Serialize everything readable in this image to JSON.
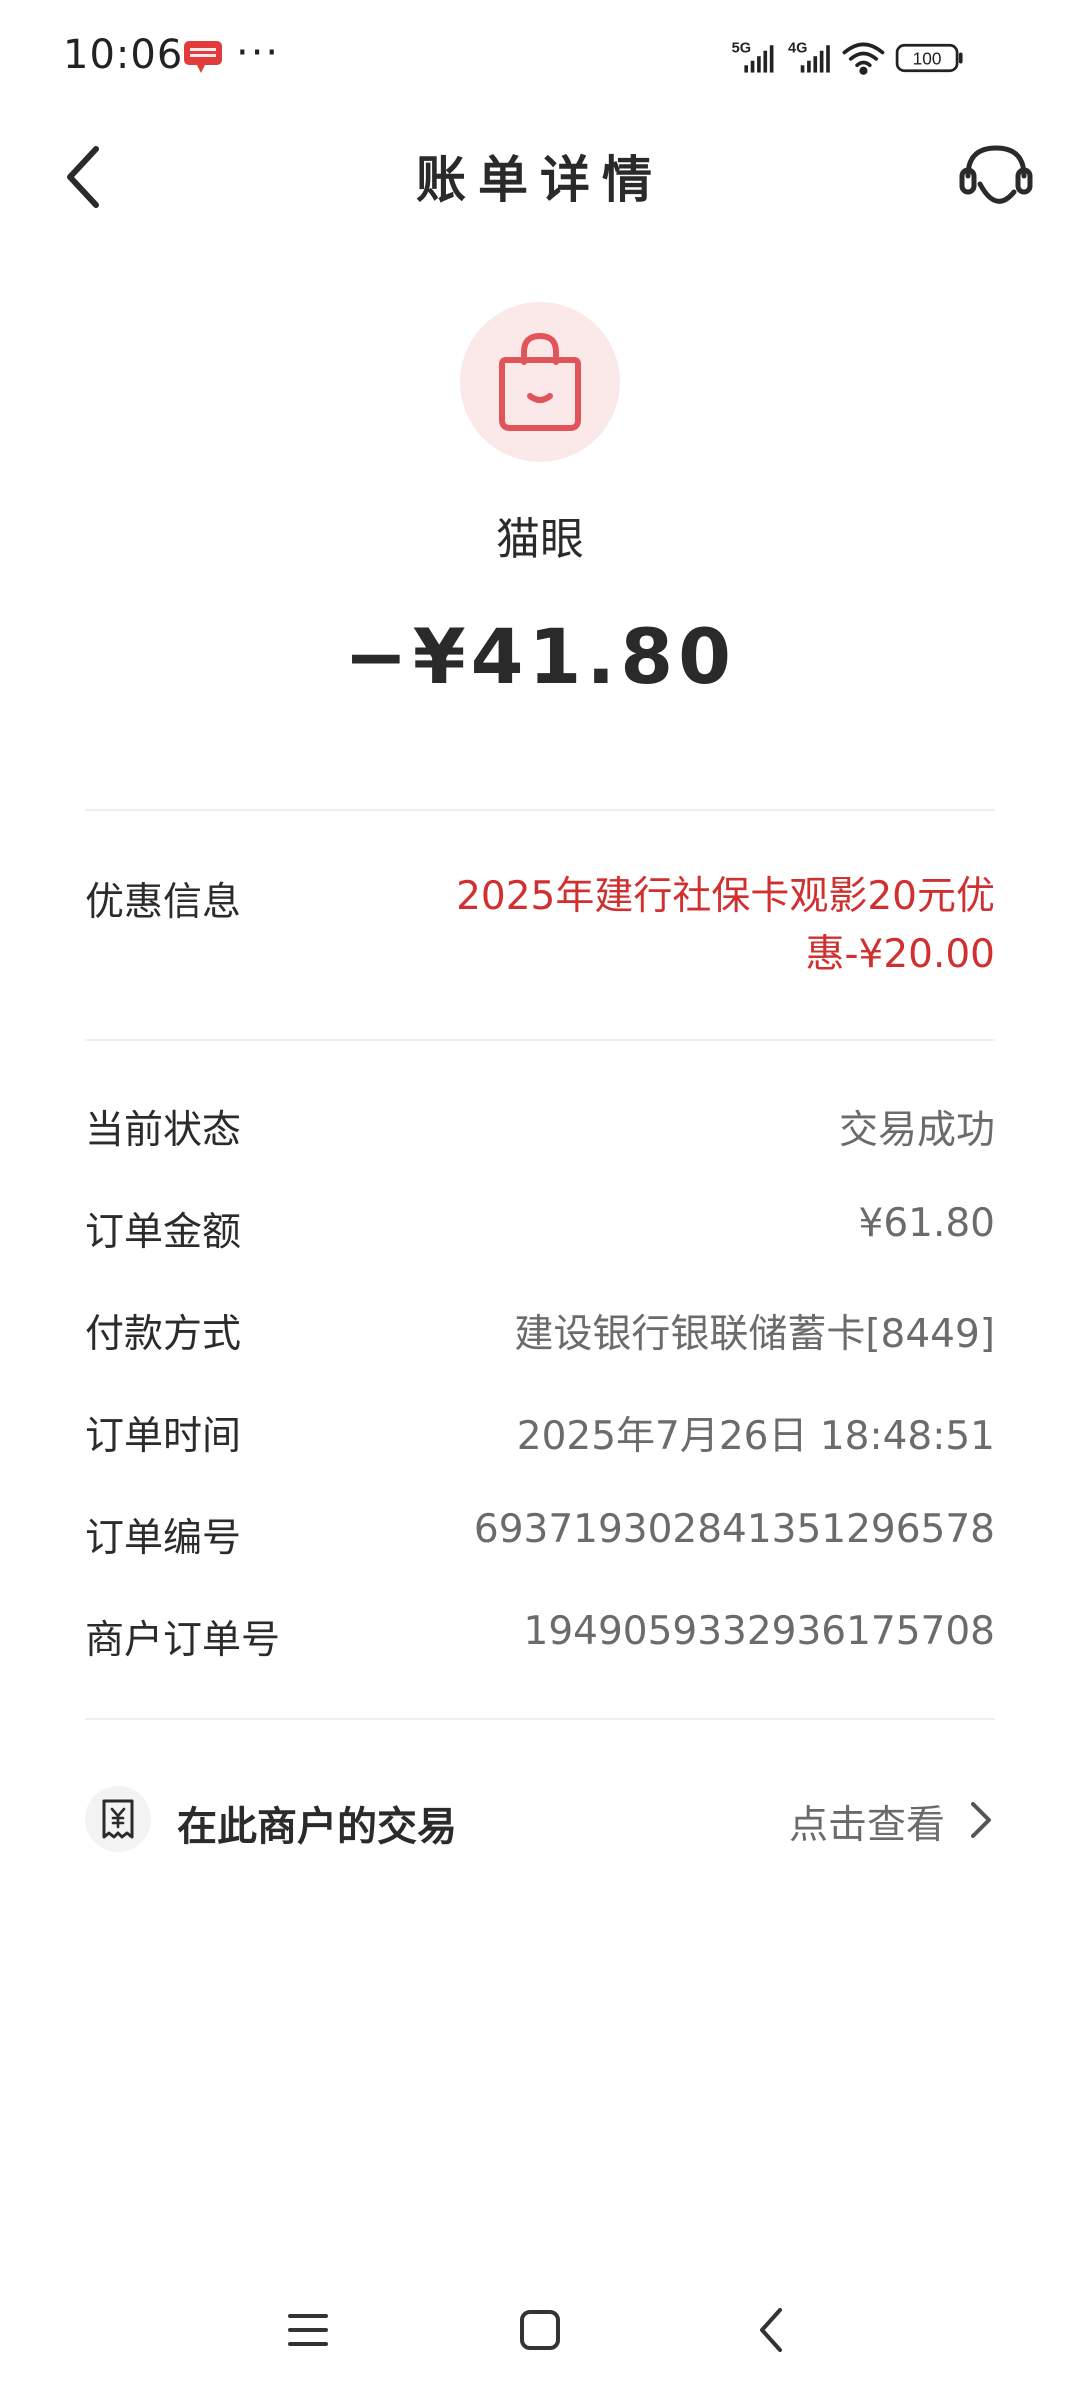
{
  "status_bar": {
    "time": "10:06",
    "more": "···",
    "network_1": "5G",
    "network_2": "4G",
    "battery": "100"
  },
  "nav": {
    "title": "账单详情"
  },
  "merchant": {
    "name": "猫眼",
    "amount": "−¥41.80",
    "icon": "shopping-bag-icon"
  },
  "discount": {
    "label": "优惠信息",
    "line1": "2025年建行社保卡观影20元优",
    "line2": "惠-¥20.00"
  },
  "details": [
    {
      "label": "当前状态",
      "value": "交易成功"
    },
    {
      "label": "订单金额",
      "value": "¥61.80"
    },
    {
      "label": "付款方式",
      "value": "建设银行银联储蓄卡[8449]"
    },
    {
      "label": "订单时间",
      "value": "2025年7月26日 18:48:51"
    },
    {
      "label": "订单编号",
      "value": "69371930284135129657​8"
    },
    {
      "label": "商户订单号",
      "value": "1949059332936175708"
    }
  ],
  "merchant_link": {
    "label": "在此商户的交易",
    "action": "点击查看"
  },
  "colors": {
    "accent_red": "#d0302f",
    "icon_red": "#e0545a",
    "icon_bg": "#fbe9ea"
  }
}
